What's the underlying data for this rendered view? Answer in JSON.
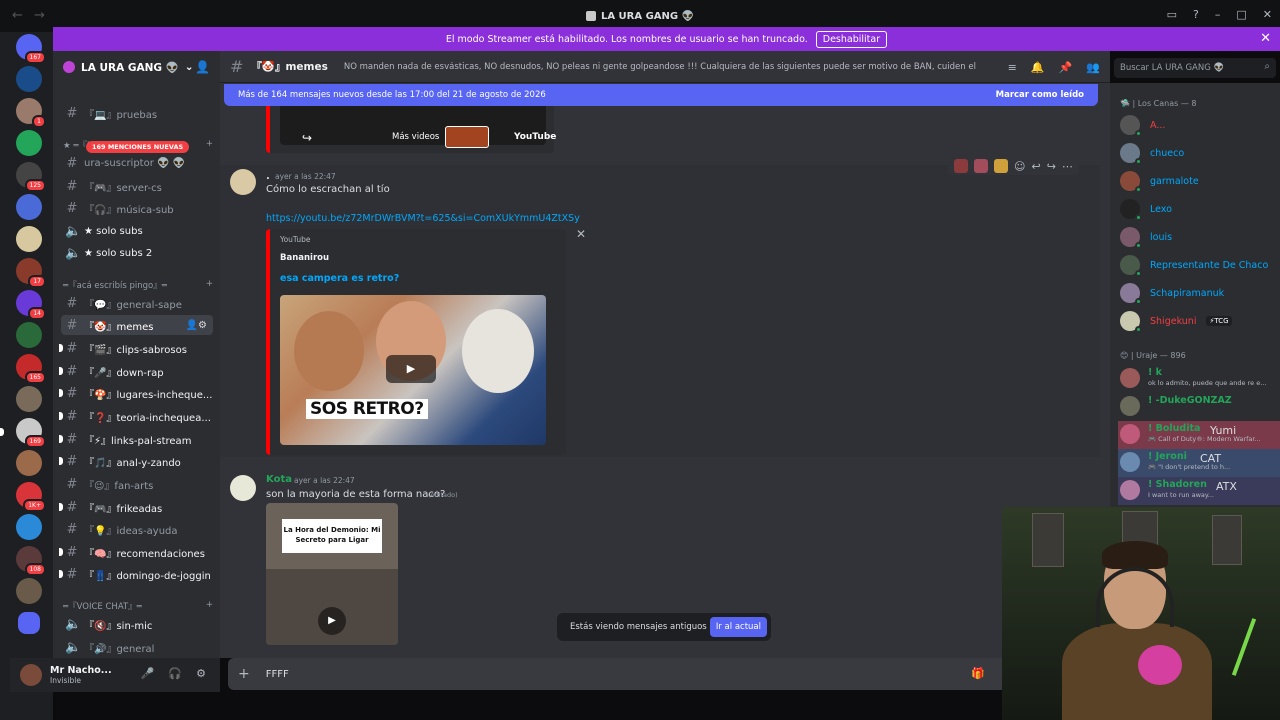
{
  "titlebar": {
    "title": "LA URA GANG 👽"
  },
  "banner": {
    "text": "El modo Streamer está habilitado. Los nombres de usuario se han truncado.",
    "button": "Deshabilitar"
  },
  "servers": {
    "badges": [
      "167",
      "1",
      "125",
      "17",
      "14",
      "165",
      "169",
      "1K+",
      "108"
    ]
  },
  "server": {
    "name": "LA URA GANG 👽",
    "mentions_pill": "169 MENCIONES NUEVAS",
    "channels": [
      {
        "name": "『💻』pruebas"
      },
      {
        "cat": "★ ═『MODO SUB』═ ★"
      },
      {
        "name": "ura-suscriptor 👽 👽"
      },
      {
        "name": "『🎮』server-cs"
      },
      {
        "name": "『🎧』música-sub"
      },
      {
        "name": "★ solo subs"
      },
      {
        "name": "★ solo subs 2"
      },
      {
        "cat": "═『acá escribís pingo』═"
      },
      {
        "name": "『💬』general-sape"
      },
      {
        "name": "『🤡』memes"
      },
      {
        "name": "『🎬』clips-sabrosos"
      },
      {
        "name": "『🎤』down-rap"
      },
      {
        "name": "『🍄』lugares-incheque..."
      },
      {
        "name": "『❓』teoria-inchequea..."
      },
      {
        "name": "『⚡』links-pal-stream"
      },
      {
        "name": "『🎵』anal-y-zando"
      },
      {
        "name": "『😉』fan-arts"
      },
      {
        "name": "『🎮』frikeadas"
      },
      {
        "name": "『💡』ideas-ayuda"
      },
      {
        "name": "『🧠』recomendaciones"
      },
      {
        "name": "『👖』domingo-de-joggin"
      },
      {
        "cat": "═『VOICE CHAT』═"
      },
      {
        "name": "『🔇』sin-mic"
      },
      {
        "name": "『🔊』general"
      }
    ]
  },
  "user": {
    "name": "Mr Nacho...",
    "status": "Invisible"
  },
  "channel": {
    "name": "『🤡』memes",
    "topic": "NO manden nada de esvásticas, NO desnudos, NO peleas ni gente golpeandose !!! Cualquiera de las siguientes puede ser motivo de BAN, cuiden el stream!"
  },
  "search": {
    "placeholder": "Buscar LA URA GANG 👽"
  },
  "newbar": {
    "text": "Más de 164 mensajes nuevos desde las 17:00 del 21 de agosto de 2026",
    "mark": "Marcar como leído"
  },
  "embed_top": {
    "more_videos": "Más videos",
    "youtube": "YouTube"
  },
  "msg1": {
    "author": ".",
    "time": "ayer a las 22:47",
    "text": "Cómo lo escrachan al tío",
    "link": "https://youtu.be/z72MrDWrBVM?t=625&si=ComXUkYmmU4ZtXSy",
    "embed": {
      "provider": "YouTube",
      "author": "Bananirou",
      "title": "esa campera es retro?",
      "caption": "SOS RETRO?"
    }
  },
  "msg2": {
    "author": "Kota",
    "time": "ayer a las 22:47",
    "text": "son la mayoria de esta forma naco?",
    "edited": "(editado)",
    "media_card": "La Hora del Demonio: Mi Secreto para Ligar"
  },
  "oldbar": {
    "text": "Estás viendo mensajes antiguos",
    "button": "Ir al actual"
  },
  "composer": {
    "value": "FFFF"
  },
  "members": {
    "group1": "🛸 | Los Canas — 8",
    "list1": [
      {
        "name": "A...",
        "color": "#f23f43"
      },
      {
        "name": "chueco",
        "color": "#00a8fc"
      },
      {
        "name": "garmalote",
        "color": "#00a8fc"
      },
      {
        "name": "Lexo",
        "color": "#00a8fc"
      },
      {
        "name": "louis",
        "color": "#00a8fc"
      },
      {
        "name": "Representante De Chaco",
        "color": "#00a8fc"
      },
      {
        "name": "Schapiramanuk",
        "color": "#00a8fc"
      },
      {
        "name": "Shigekuni",
        "color": "#f23f43",
        "tag": "⚡TCG"
      }
    ],
    "group2": "😊 | Uraje — 896",
    "list2": [
      {
        "name": "! k",
        "act": "ok lo admito, puede que ande re e...",
        "color": "#23a55a"
      },
      {
        "name": "! -DukeGONZAZ",
        "act": "",
        "color": "#23a55a"
      },
      {
        "name": "! Boludita",
        "act": "🎮 Call of Duty®: Modern Warfar...",
        "color": "#23a55a",
        "tag": "Yumi"
      },
      {
        "name": "! Jeroni",
        "act": "🎮 \"I don't pretend to h...",
        "color": "#23a55a",
        "tag": "CAT"
      },
      {
        "name": "! Shadoren",
        "act": "I want to run away...",
        "color": "#23a55a",
        "tag": "ATX"
      }
    ]
  },
  "colors": {
    "accent": "#5865f2",
    "banner": "#8a2fd9",
    "youtube": "#ff0000"
  }
}
